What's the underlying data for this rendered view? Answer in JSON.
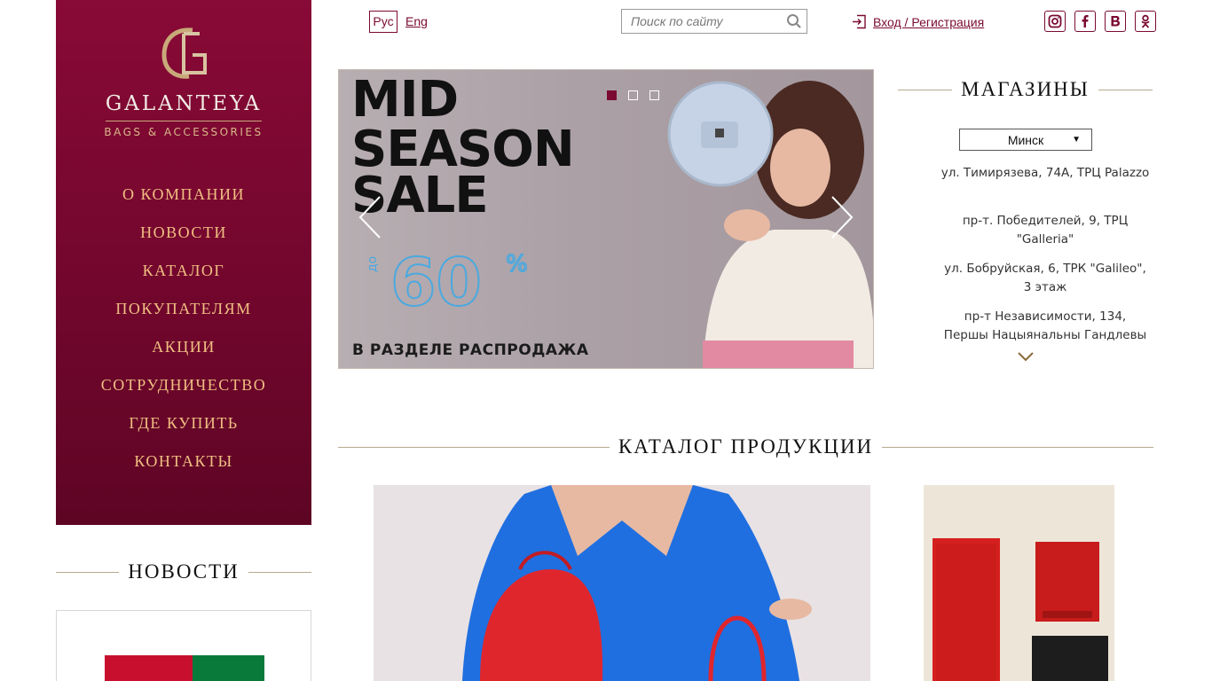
{
  "sidebar": {
    "logo": {
      "monogram": "GG",
      "name": "GALANTEYA",
      "tagline": "BAGS & ACCESSORIES"
    },
    "nav": [
      {
        "label": "О КОМПАНИИ"
      },
      {
        "label": "НОВОСТИ"
      },
      {
        "label": "КАТАЛОГ"
      },
      {
        "label": "ПОКУПАТЕЛЯМ"
      },
      {
        "label": "АКЦИИ"
      },
      {
        "label": "СОТРУДНИЧЕСТВО"
      },
      {
        "label": "ГДЕ КУПИТЬ"
      },
      {
        "label": "КОНТАКТЫ"
      }
    ]
  },
  "news": {
    "heading": "НОВОСТИ"
  },
  "header": {
    "lang_ru": "Рус",
    "lang_en": "Eng",
    "search_placeholder": "Поиск по сайту",
    "login": "Вход / Регистрация",
    "socials": [
      "instagram-icon",
      "facebook-icon",
      "vk-icon",
      "odnoklassniki-icon"
    ]
  },
  "banner": {
    "line1": "MID",
    "line2": "SEASON",
    "line3": "SALE",
    "upto": "до",
    "percent": "60",
    "percent_sign": "%",
    "subtitle": "В РАЗДЕЛЕ РАСПРОДАЖА",
    "active_slide": 1,
    "slide_count": 3
  },
  "stores": {
    "heading": "МАГАЗИНЫ",
    "city": "Минск",
    "addresses": [
      "ул. Тимирязева, 74А, ТРЦ Palazzo",
      "пр-т. Победителей, 9, ТРЦ \"Galleria\"",
      "ул. Бобруйская, 6, ТРК \"Galileo\", 3 этаж",
      "пр-т Независимости, 134, Першы Нацыянальны Гандлевы"
    ]
  },
  "catalog": {
    "heading": "КАТАЛОГ ПРОДУКЦИИ"
  },
  "colors": {
    "brand": "#7a0a32",
    "nav_text": "#f0bf82",
    "rule": "#b9a98e"
  }
}
